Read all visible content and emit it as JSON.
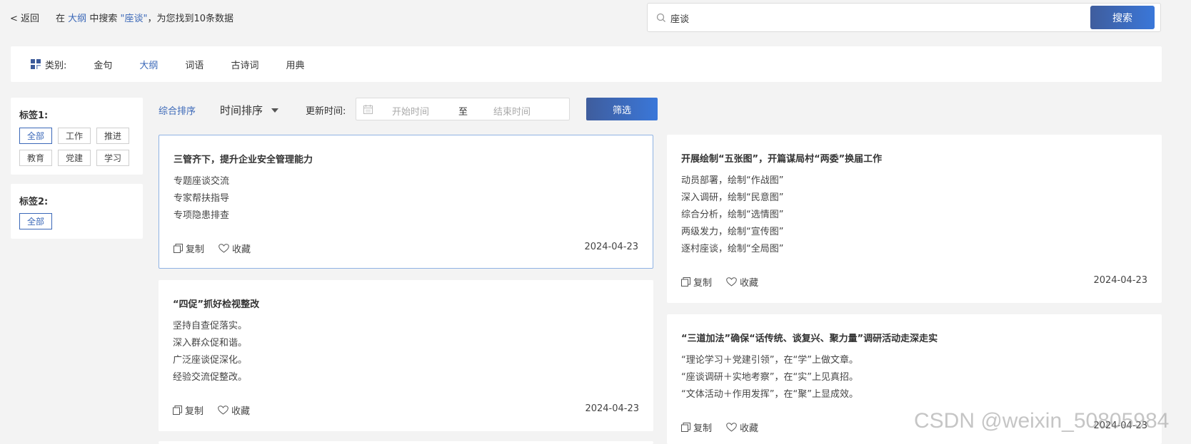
{
  "header": {
    "back_label": "< 返回",
    "crumb_prefix": "在",
    "crumb_scope": "大纲",
    "crumb_mid": "中搜索",
    "crumb_query": "\"座谈\"",
    "crumb_suffix": "，为您找到10条数据"
  },
  "search": {
    "value": "座谈",
    "button_label": "搜索"
  },
  "categories": {
    "label": "类别:",
    "items": [
      "金句",
      "大纲",
      "词语",
      "古诗词",
      "用典"
    ],
    "active": "大纲"
  },
  "tags1": {
    "title": "标签1:",
    "items": [
      "全部",
      "工作",
      "推进",
      "教育",
      "党建",
      "学习"
    ],
    "active": "全部"
  },
  "tags2": {
    "title": "标签2:",
    "items": [
      "全部"
    ],
    "active": "全部"
  },
  "sort": {
    "composite": "综合排序",
    "time": "时间排序",
    "update_label": "更新时间:",
    "start_placeholder": "开始时间",
    "to": "至",
    "end_placeholder": "结束时间",
    "filter_label": "筛选"
  },
  "card_actions": {
    "copy": "复制",
    "favorite": "收藏"
  },
  "cards": [
    {
      "title": "三管齐下，提升企业安全管理能力",
      "lines": [
        "专题座谈交流",
        "专家帮扶指导",
        "专项隐患排查"
      ],
      "date": "2024-04-23"
    },
    {
      "title": "开展绘制“五张图”，开篇谋局村“两委”换届工作",
      "lines": [
        "动员部署，绘制“作战图”",
        "深入调研，绘制“民意图”",
        "综合分析，绘制“选情图”",
        "两级发力，绘制“宣传图”",
        "逐村座谈，绘制“全局图”"
      ],
      "date": "2024-04-23"
    },
    {
      "title": "“四促”抓好检视整改",
      "lines": [
        "坚持自查促落实。",
        "深入群众促和谐。",
        "广泛座谈促深化。",
        "经验交流促整改。"
      ],
      "date": "2024-04-23"
    },
    {
      "title": "“三道加法”确保“话传统、谈复兴、聚力量”调研活动走深走实",
      "lines": [
        "“理论学习＋党建引领”，在“学”上做文章。",
        "“座谈调研＋实地考察”，在“实”上见真招。",
        "“文体活动＋作用发挥”，在“聚”上显成效。"
      ],
      "date": "2024-04-23"
    }
  ],
  "watermark": "CSDN @weixin_50805984"
}
